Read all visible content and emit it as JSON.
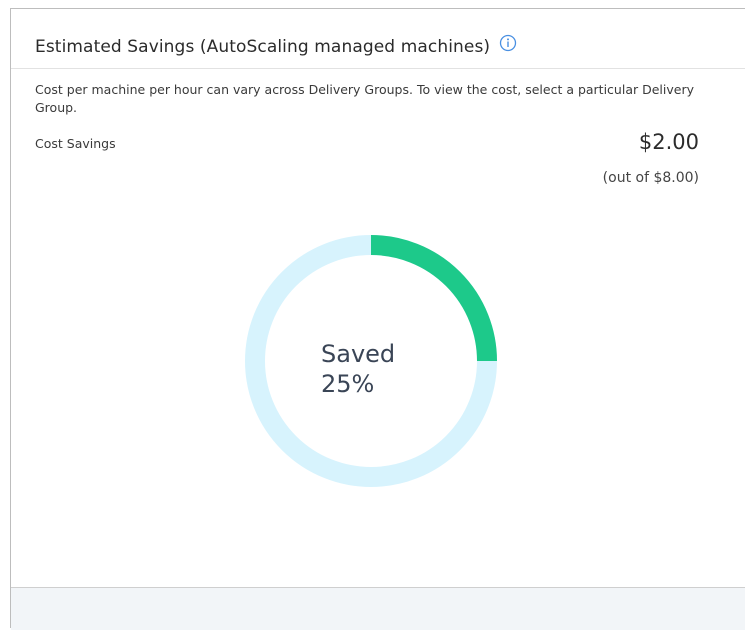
{
  "card": {
    "title": "Estimated Savings (AutoScaling managed machines)",
    "info_icon": "info-circle-icon",
    "description": "Cost per machine per hour can vary across Delivery Groups. To view the cost, select a particular Delivery Group.",
    "cost_label": "Cost Savings",
    "amount": "$2.00",
    "total": "(out of $8.00)",
    "saved_label": "Saved",
    "saved_percent_text": "25%"
  },
  "gauge": {
    "saved_fraction": 0.25,
    "saved_color": "#1dc98a",
    "track_color": "#d7f3fd"
  },
  "colors": {
    "accent_info": "#4a90e2"
  }
}
